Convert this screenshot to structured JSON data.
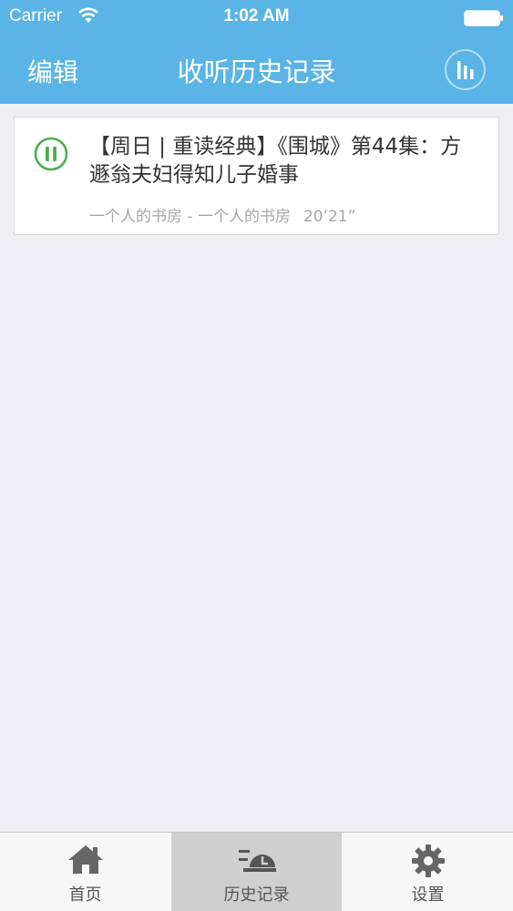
{
  "status_bar": {
    "carrier": "Carrier",
    "time": "1:02 AM"
  },
  "nav": {
    "edit_label": "编辑",
    "title": "收听历史记录"
  },
  "history": [
    {
      "title": "【周日 | 重读经典】《围城》第44集：方遯翁夫妇得知儿子婚事",
      "source": "一个人的书房 - 一个人的书房",
      "duration": "20’21”",
      "state": "playing"
    }
  ],
  "tabs": [
    {
      "label": "首页",
      "icon": "home-icon",
      "active": false
    },
    {
      "label": "历史记录",
      "icon": "history-icon",
      "active": true
    },
    {
      "label": "设置",
      "icon": "gear-icon",
      "active": false
    }
  ],
  "colors": {
    "accent": "#5ab4e6",
    "play_green": "#4cae4c",
    "background": "#efeff4"
  }
}
